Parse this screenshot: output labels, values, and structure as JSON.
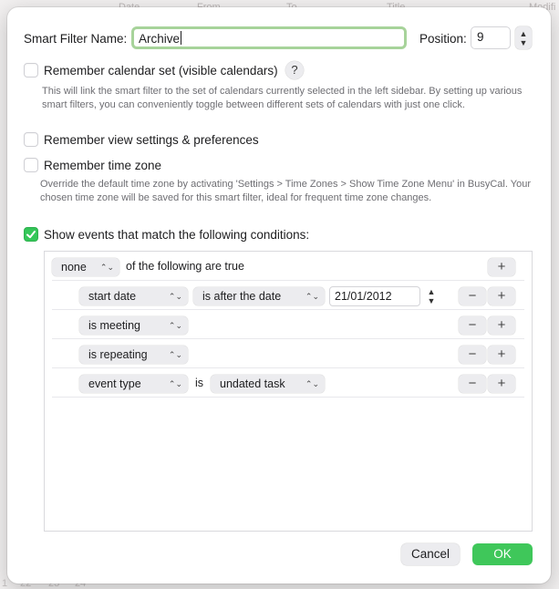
{
  "background": {
    "headers": [
      "Date",
      "From",
      "To",
      "Title",
      "Modifi"
    ],
    "bottom_numbers": [
      "1",
      "22",
      "23",
      "24"
    ]
  },
  "dialog": {
    "name_label": "Smart Filter Name:",
    "name_value": "Archive",
    "position_label": "Position:",
    "position_value": "9",
    "options": [
      {
        "label": "Remember calendar set (visible calendars)",
        "checked": false,
        "help": "?",
        "hint": "This will link the smart filter to the set of calendars currently selected in the left sidebar. By setting up various smart filters, you can conveniently toggle between different sets of calendars with just one click."
      },
      {
        "label": "Remember view settings & preferences",
        "checked": false
      },
      {
        "label": "Remember time zone",
        "checked": false,
        "hint": "Override the default time zone by activating 'Settings > Time Zones > Show Time Zone Menu' in BusyCal. Your chosen time zone will be saved for this smart filter, ideal for frequent time zone changes."
      },
      {
        "label": "Show events that match the following conditions:",
        "checked": true
      }
    ],
    "conditions": {
      "quantifier": "none",
      "quantifier_suffix": "of the following are true",
      "rules": [
        {
          "field": "start date",
          "operator": "is after the date",
          "value": "21/01/2012"
        },
        {
          "field": "is meeting"
        },
        {
          "field": "is repeating"
        },
        {
          "field": "event type",
          "connector": "is",
          "value": "undated task"
        }
      ],
      "add_symbol": "+",
      "remove_symbol": "−"
    },
    "buttons": {
      "cancel": "Cancel",
      "ok": "OK"
    }
  },
  "colors": {
    "accent_green": "#34c759",
    "focus_ring": "#a7d39a"
  }
}
